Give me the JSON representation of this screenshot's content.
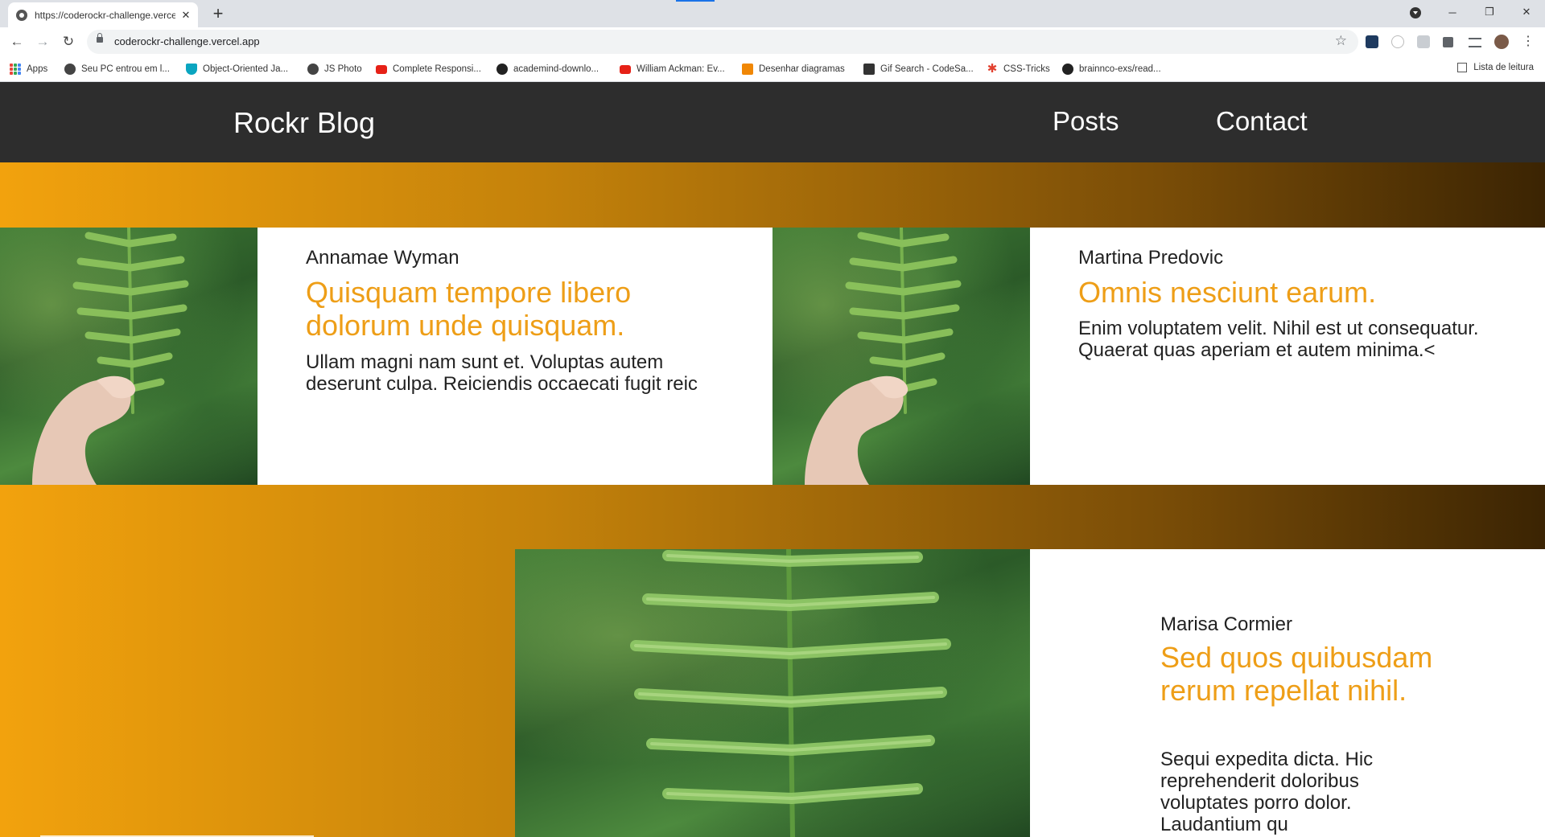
{
  "browser": {
    "tab_title": "https://coderockr-challenge.vercel.app",
    "url": "coderockr-challenge.vercel.app",
    "icons": {
      "tab_close": "close-icon",
      "new_tab": "plus-icon",
      "back": "arrow-left-icon",
      "forward": "arrow-right-icon",
      "reload": "reload-icon",
      "bookmark_star": "star-icon",
      "menu": "kebab-icon"
    },
    "bookmarks": [
      {
        "label": "Apps",
        "icon": "apps-grid-icon"
      },
      {
        "label": "Seu PC entrou em l...",
        "icon": "globe-icon"
      },
      {
        "label": "Object-Oriented Ja...",
        "icon": "udemy-icon"
      },
      {
        "label": "JS Photo",
        "icon": "globe-icon"
      },
      {
        "label": "Complete Responsi...",
        "icon": "youtube-icon"
      },
      {
        "label": "academind-downlo...",
        "icon": "github-icon"
      },
      {
        "label": "William Ackman: Ev...",
        "icon": "youtube-icon"
      },
      {
        "label": "Desenhar diagramas",
        "icon": "drawio-icon"
      },
      {
        "label": "Gif Search - CodeSa...",
        "icon": "codesandbox-icon"
      },
      {
        "label": "CSS-Tricks",
        "icon": "css-tricks-icon"
      },
      {
        "label": "brainnco-exs/read...",
        "icon": "github-icon"
      }
    ],
    "reading_list": "Lista de leitura"
  },
  "site": {
    "logo": "Rockr Blog",
    "nav": [
      "Posts",
      "Contact"
    ],
    "gradient_colors": [
      "#f2a20d",
      "#3b2403"
    ],
    "accent_color": "#ee9e17"
  },
  "posts": [
    {
      "author": "Annamae Wyman",
      "title": "Quisquam tempore libero dolorum unde quisquam.",
      "excerpt": "Ullam magni nam sunt et. Voluptas autem deserunt culpa. Reiciendis occaecati fugit reic"
    },
    {
      "author": "Martina Predovic",
      "title": "Omnis nesciunt earum.",
      "excerpt": "Enim voluptatem velit. Nihil est ut consequatur. Quaerat quas aperiam et autem minima.<"
    },
    {
      "author": "Marisa Cormier",
      "title": "Sed quos quibusdam rerum repellat nihil.",
      "excerpt": "Sequi expedita dicta. Hic reprehenderit doloribus voluptates porro dolor. Laudantium qu"
    }
  ]
}
